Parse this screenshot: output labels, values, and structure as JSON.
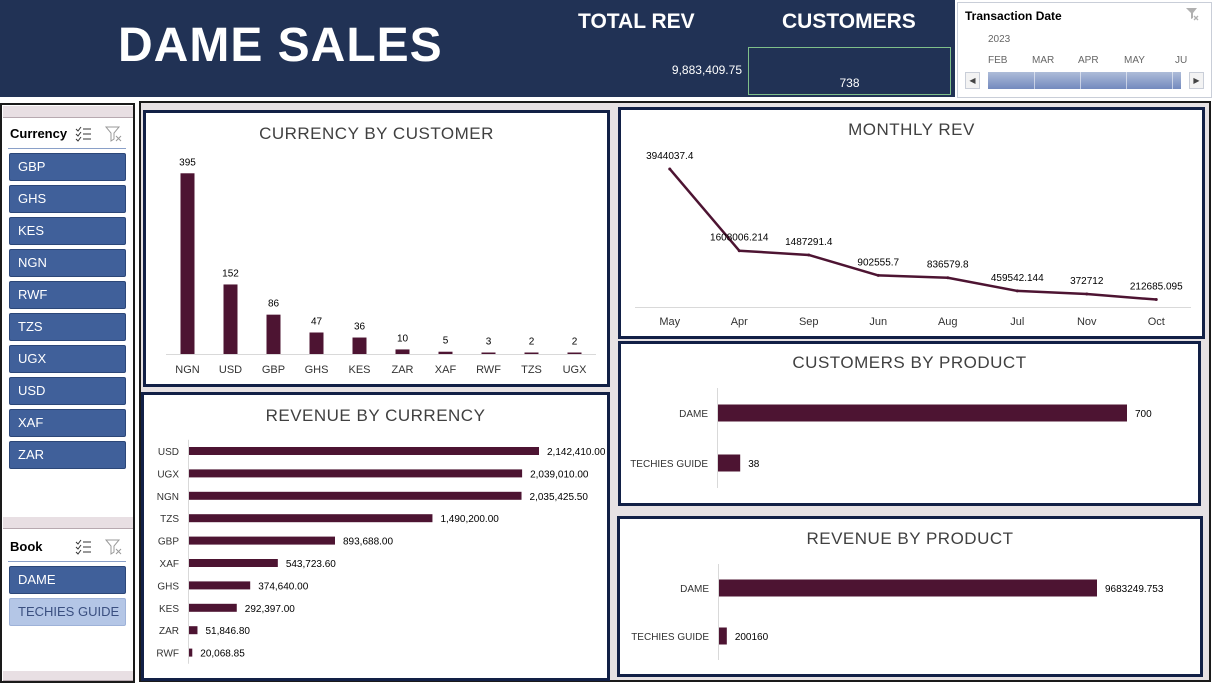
{
  "header": {
    "title": "DAME SALES",
    "total_rev_label": "TOTAL REV",
    "customers_label": "CUSTOMERS",
    "total_rev_value": "9,883,409.75",
    "customers_value": "738",
    "background_color": "#213255"
  },
  "timeline": {
    "title": "Transaction Date",
    "filter_icon": "clear-filter-icon",
    "year": "2023",
    "months": [
      "FEB",
      "MAR",
      "APR",
      "MAY",
      "JU"
    ]
  },
  "currency_slicer": {
    "title": "Currency",
    "multiselect_icon": "multi-select-icon",
    "filter_icon": "clear-filter-icon",
    "items": [
      {
        "label": "GBP",
        "selected": true
      },
      {
        "label": "GHS",
        "selected": true
      },
      {
        "label": "KES",
        "selected": true
      },
      {
        "label": "NGN",
        "selected": true
      },
      {
        "label": "RWF",
        "selected": true
      },
      {
        "label": "TZS",
        "selected": true
      },
      {
        "label": "UGX",
        "selected": true
      },
      {
        "label": "USD",
        "selected": true
      },
      {
        "label": "XAF",
        "selected": true
      },
      {
        "label": "ZAR",
        "selected": true
      }
    ]
  },
  "book_slicer": {
    "title": "Book",
    "multiselect_icon": "multi-select-icon",
    "filter_icon": "clear-filter-icon",
    "items": [
      {
        "label": "DAME",
        "selected": true
      },
      {
        "label": "TECHIES GUIDE",
        "selected": false
      }
    ]
  },
  "colors": {
    "bar": "#4d1432",
    "panel_border": "#122046",
    "slicer_selected": "#40609a",
    "slicer_unselected": "#b4c6e6"
  },
  "chart_data": [
    {
      "id": "currency-by-customer",
      "type": "bar",
      "title": "CURRENCY BY CUSTOMER",
      "categories": [
        "NGN",
        "USD",
        "GBP",
        "GHS",
        "KES",
        "ZAR",
        "XAF",
        "RWF",
        "TZS",
        "UGX"
      ],
      "values": [
        395,
        152,
        86,
        47,
        36,
        10,
        5,
        3,
        2,
        2
      ],
      "data_labels": [
        "395",
        "152",
        "86",
        "47",
        "36",
        "10",
        "5",
        "3",
        "2",
        "2"
      ],
      "ylim": [
        0,
        400
      ]
    },
    {
      "id": "monthly-rev",
      "type": "line",
      "title": "MONTHLY REV",
      "categories": [
        "May",
        "Apr",
        "Sep",
        "Jun",
        "Aug",
        "Jul",
        "Nov",
        "Oct"
      ],
      "values": [
        3944037.4,
        1608006.214,
        1487291.4,
        902555.7,
        836579.8,
        459542.144,
        372712,
        212685.095
      ],
      "data_labels": [
        "3944037.4",
        "1608006.214",
        "1487291.4",
        "902555.7",
        "836579.8",
        "459542.144",
        "372712",
        "212685.095"
      ],
      "ylim": [
        0,
        4200000
      ]
    },
    {
      "id": "revenue-by-currency",
      "type": "bar",
      "orientation": "horizontal",
      "title": "REVENUE BY CURRENCY",
      "categories": [
        "USD",
        "UGX",
        "NGN",
        "TZS",
        "GBP",
        "XAF",
        "GHS",
        "KES",
        "ZAR",
        "RWF"
      ],
      "values": [
        2142410.0,
        2039010.0,
        2035425.5,
        1490200.0,
        893688.0,
        543723.6,
        374640.0,
        292397.0,
        51846.8,
        20068.85
      ],
      "data_labels": [
        "2,142,410.00",
        "2,039,010.00",
        "2,035,425.50",
        "1,490,200.00",
        "893,688.00",
        "543,723.60",
        "374,640.00",
        "292,397.00",
        "51,846.80",
        "20,068.85"
      ],
      "xlim": [
        0,
        2142410
      ]
    },
    {
      "id": "customers-by-product",
      "type": "bar",
      "orientation": "horizontal",
      "title": "CUSTOMERS BY PRODUCT",
      "categories": [
        "DAME",
        "TECHIES GUIDE"
      ],
      "values": [
        700,
        38
      ],
      "data_labels": [
        "700",
        "38"
      ],
      "xlim": [
        0,
        700
      ]
    },
    {
      "id": "revenue-by-product",
      "type": "bar",
      "orientation": "horizontal",
      "title": "REVENUE BY PRODUCT",
      "categories": [
        "DAME",
        "TECHIES GUIDE"
      ],
      "values": [
        9683249.753,
        200160
      ],
      "data_labels": [
        "9683249.753",
        "200160"
      ],
      "xlim": [
        0,
        9683249.753
      ]
    }
  ]
}
